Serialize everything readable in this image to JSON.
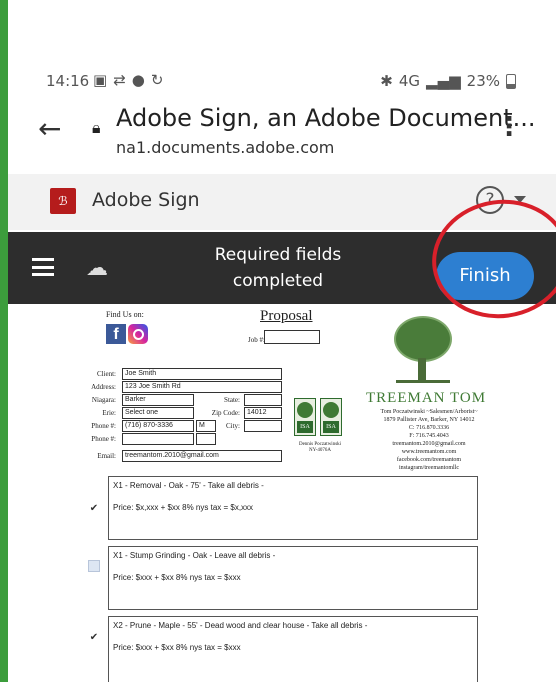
{
  "status_bar": {
    "time": "14:16",
    "network": "4G",
    "battery": "23%"
  },
  "browser": {
    "title": "Adobe Sign, an Adobe Document...",
    "url": "na1.documents.adobe.com"
  },
  "app_header": {
    "name": "Adobe Sign",
    "help_symbol": "?"
  },
  "toolbar": {
    "message_line1": "Required fields",
    "message_line2": "completed",
    "finish_label": "Finish"
  },
  "document": {
    "find_us": "Find Us on:",
    "title": "Proposal",
    "job_label": "Job #:",
    "fields": {
      "client_label": "Client:",
      "client": "Joe Smith",
      "address_label": "Address:",
      "address": "123 Joe Smith Rd",
      "city_label": "Niagara:",
      "city": "Barker",
      "state_label": "State:",
      "state": "",
      "county_label": "Erie:",
      "county": "Select one",
      "zip_label": "Zip Code:",
      "zip": "14012",
      "phone_label": "Phone #:",
      "phone": "(716) 870-3336",
      "phone_type": "M",
      "city2_label": "City:",
      "phone2_label": "Phone #:",
      "email_label": "Email:",
      "email": "treemantom.2010@gmail.com"
    },
    "company": {
      "name": "TREEMAN TOM",
      "info_lines": [
        "Tom Poczatwinski ~Salesmen/Arborist~",
        "1879 Pallister Ave, Barker, NY 14012",
        "C: 716.870.3336",
        "F: 716.745.4043",
        "treemantom.2010@gmail.com",
        "www.treemantom.com",
        "facebook.com/treemantom",
        "instagram/treemantomllc"
      ],
      "cert_name": "Dennis Poczatwinski",
      "cert_id": "NY-4076A"
    },
    "line_items": [
      {
        "title": "X1 - Removal - Oak - 75' - Take all debris -",
        "price": "Price: $x,xxx + $xx 8% nys tax = $x,xxx",
        "checked": true
      },
      {
        "title": "X1 - Stump Grinding - Oak - Leave all debris -",
        "price": "Price: $xxx + $xx 8% nys tax = $xxx",
        "checked": false
      },
      {
        "title": "X2 - Prune - Maple - 55' - Dead wood and clear house - Take all debris -",
        "price": "Price: $xxx + $xx 8% nys tax = $xxx",
        "checked": true
      }
    ]
  },
  "colors": {
    "finish_button": "#2d7fd1",
    "toolbar_bg": "#2d2d2d",
    "highlight_ring": "#d8202a",
    "brand_green": "#3f7a34"
  }
}
